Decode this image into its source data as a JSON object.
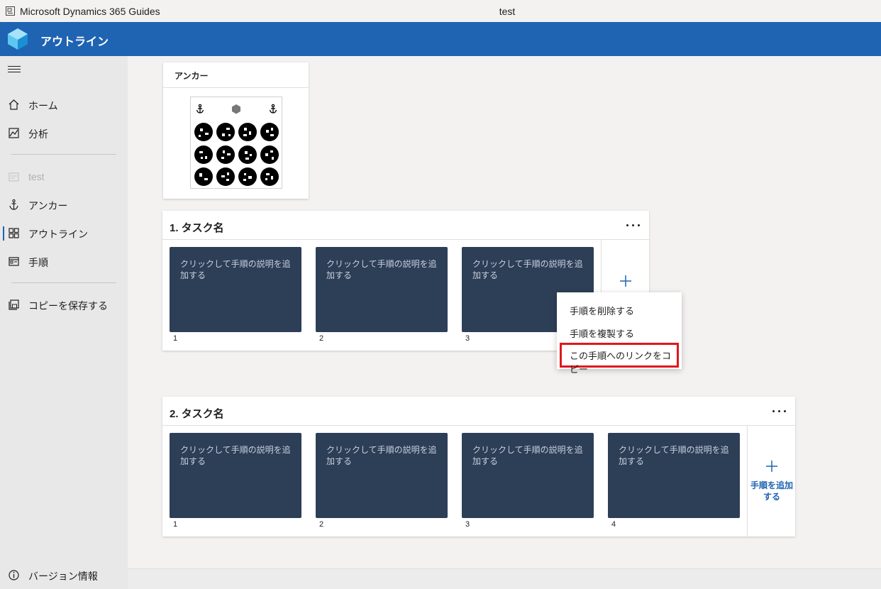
{
  "titlebar": {
    "app_name": "Microsoft Dynamics 365 Guides",
    "document_title": "test"
  },
  "header": {
    "title": "アウトライン"
  },
  "sidebar": {
    "items": [
      {
        "label": "ホーム",
        "icon": "home-icon"
      },
      {
        "label": "分析",
        "icon": "analytics-icon"
      },
      {
        "label": "test",
        "icon": "guide-icon",
        "disabled": true
      },
      {
        "label": "アンカー",
        "icon": "anchor-icon"
      },
      {
        "label": "アウトライン",
        "icon": "outline-icon",
        "active": true
      },
      {
        "label": "手順",
        "icon": "steps-icon"
      },
      {
        "label": "コピーを保存する",
        "icon": "save-copy-icon"
      }
    ],
    "about_label": "バージョン情報"
  },
  "anchor_card": {
    "title": "アンカー"
  },
  "tasks": [
    {
      "title": "1.  タスク名",
      "steps": [
        {
          "text": "クリックして手順の説明を追加する",
          "number": "1"
        },
        {
          "text": "クリックして手順の説明を追加する",
          "number": "2"
        },
        {
          "text": "クリックして手順の説明を追加する",
          "number": "3"
        }
      ]
    },
    {
      "title": "2.  タスク名",
      "steps": [
        {
          "text": "クリックして手順の説明を追加する",
          "number": "1"
        },
        {
          "text": "クリックして手順の説明を追加する",
          "number": "2"
        },
        {
          "text": "クリックして手順の説明を追加する",
          "number": "3"
        },
        {
          "text": "クリックして手順の説明を追加する",
          "number": "4"
        }
      ],
      "add_step_label": "手順を追加する"
    }
  ],
  "context_menu": {
    "items": [
      "手順を削除する",
      "手順を複製する",
      "この手順へのリンクをコピー"
    ],
    "highlighted_item": "この手順へのリンクをコピー"
  },
  "colors": {
    "brand": "#1f63b3",
    "tile": "#2d3e57",
    "highlight": "#e0171e"
  }
}
